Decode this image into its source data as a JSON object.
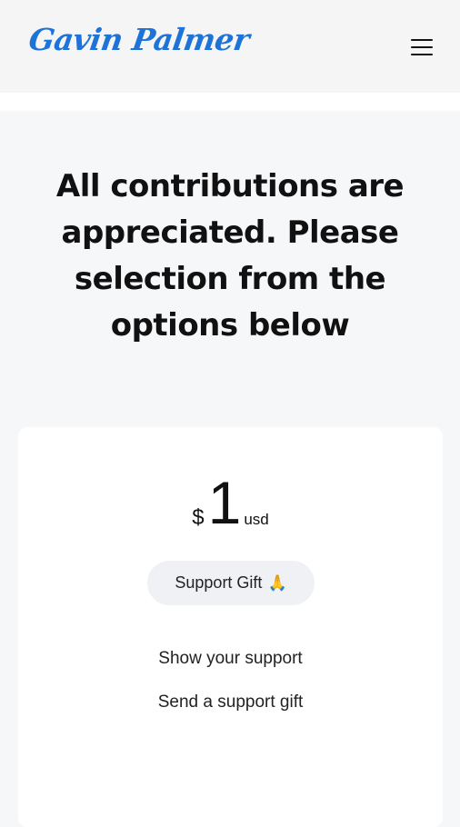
{
  "header": {
    "logo_text": "Gavin Palmer",
    "menu_icon": "hamburger-menu-icon"
  },
  "headline": "All contributions are appreciated. Please selection from the options below",
  "card": {
    "currency_symbol": "$",
    "amount": "1",
    "unit": "usd",
    "button_label": "Support Gift",
    "button_icon": "🙏",
    "features": [
      "Show your support",
      "Send a support gift"
    ]
  },
  "colors": {
    "logo": "#1e73d8",
    "page_bg": "#f6f7f9",
    "card_bg": "#ffffff",
    "button_bg": "#f0f1f4"
  }
}
